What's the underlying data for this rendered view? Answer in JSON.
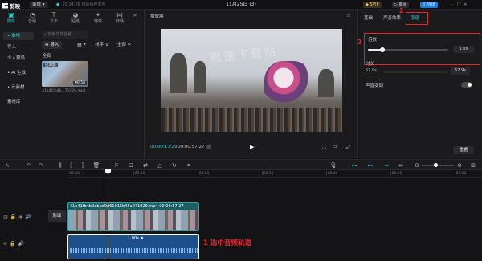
{
  "topbar": {
    "app_name": "剪映",
    "menu": "菜单 ▾",
    "autosave": "10:14:28 自动保存本地",
    "title": "11月25日 (3)",
    "svip": "SVIP",
    "review": "审阅",
    "export": "导出"
  },
  "left_tabs": [
    {
      "label": "媒体",
      "icon": "▣"
    },
    {
      "label": "音频",
      "icon": "◔"
    },
    {
      "label": "文本",
      "icon": "T"
    },
    {
      "label": "贴纸",
      "icon": "◕"
    },
    {
      "label": "特效",
      "icon": "✦"
    },
    {
      "label": "转场",
      "icon": "⋈"
    }
  ],
  "left_nav": [
    "• 本地",
    "导入",
    "个人预设",
    "• AI 生成",
    "• 云素材",
    "素材库"
  ],
  "media": {
    "import_label": "导入",
    "search_placeholder": "搜索文件名称",
    "sort_label": "排序",
    "all_filter": "全部",
    "all_section": "全部",
    "clip_tag": "已添加",
    "clip_duration": "00:58",
    "clip_name": "41a41fb4b...71929.mp4"
  },
  "player": {
    "header": "播放器",
    "watermark": "极速下载站",
    "current_time": "00:00:17:29",
    "total_time": "00:00:57:27"
  },
  "right_tabs": [
    "基础",
    "声音效果",
    "变速"
  ],
  "speed": {
    "multiplier_label": "倍数",
    "multiplier_value": "1.0x",
    "multiplier_fraction": 0.18,
    "duration_label": "时长",
    "duration_from": "57.9s",
    "duration_to": "57.9s",
    "pitch_label": "声音变调",
    "reset_label": "重置"
  },
  "timeline": {
    "ticks": [
      "00:00",
      "|00:10",
      "|00:20",
      "|00:30",
      "|00:40",
      "|00:50",
      "|01:00"
    ],
    "cover_label": "封面",
    "video_clip_caption": "41a41fb4b9dbed9d61016b45e071929.mp4  00:00:57:27",
    "audio_speed": "1.00x ♦"
  },
  "annotations": {
    "step1": "1 选中音频轨道",
    "step2": "2",
    "step3": "3"
  },
  "colors": {
    "accent": "#2ed0d8",
    "annotation": "#e5252a",
    "export_button": "#1e7bd9"
  }
}
